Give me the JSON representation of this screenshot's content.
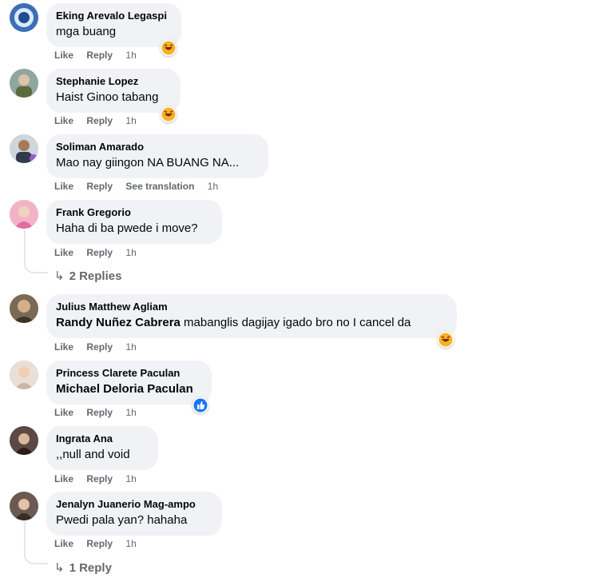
{
  "comments": [
    {
      "author": "Eking Arevalo Legaspi",
      "text": "mga buang",
      "actions": [
        "Like",
        "Reply"
      ],
      "time": "1h",
      "reaction": "haha"
    },
    {
      "author": "Stephanie Lopez",
      "text": "Haist Ginoo tabang",
      "actions": [
        "Like",
        "Reply"
      ],
      "time": "1h",
      "reaction": "haha"
    },
    {
      "author": "Soliman Amarado",
      "text": "Mao nay giingon NA BUANG NA...",
      "actions": [
        "Like",
        "Reply",
        "See translation"
      ],
      "time": "1h"
    },
    {
      "author": "Frank Gregorio",
      "text": "Haha di ba pwede i move?",
      "actions": [
        "Like",
        "Reply"
      ],
      "time": "1h",
      "replies": "2 Replies"
    },
    {
      "author": "Julius Matthew Agliam",
      "tag": "Randy Nuñez Cabrera",
      "text": " mabanglis dagijay igado bro no I cancel da",
      "actions": [
        "Like",
        "Reply"
      ],
      "time": "1h",
      "reaction": "haha"
    },
    {
      "author": "Princess Clarete Paculan",
      "tag": "Michael Deloria Paculan",
      "text": "",
      "actions": [
        "Like",
        "Reply"
      ],
      "time": "1h",
      "reaction": "like"
    },
    {
      "author": "Ingrata Ana",
      "text": ",,null and void",
      "actions": [
        "Like",
        "Reply"
      ],
      "time": "1h"
    },
    {
      "author": "Jenalyn Juanerio Mag-ampo",
      "text": "Pwedi pala yan? hahaha",
      "actions": [
        "Like",
        "Reply"
      ],
      "time": "1h",
      "replies": "1 Reply"
    }
  ],
  "reply_arrow": "↳",
  "colors": {
    "bubble": "#f0f2f5",
    "meta": "#65676b",
    "like_blue": "#1877f2",
    "haha_yellow": "#f7b125"
  }
}
